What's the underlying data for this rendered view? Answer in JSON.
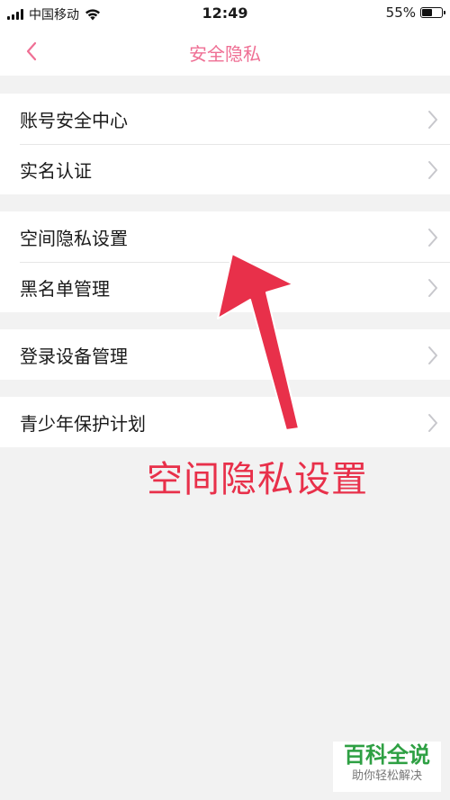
{
  "status_bar": {
    "carrier": "中国移动",
    "time": "12:49",
    "battery_pct": "55%",
    "battery_level": 0.55
  },
  "nav": {
    "title": "安全隐私",
    "back_icon": "chevron-left-icon"
  },
  "groups": [
    {
      "items": [
        {
          "label": "账号安全中心"
        },
        {
          "label": "实名认证"
        }
      ]
    },
    {
      "items": [
        {
          "label": "空间隐私设置"
        },
        {
          "label": "黑名单管理"
        }
      ]
    },
    {
      "items": [
        {
          "label": "登录设备管理"
        }
      ]
    },
    {
      "items": [
        {
          "label": "青少年保护计划"
        }
      ]
    }
  ],
  "annotation": {
    "text": "空间隐私设置",
    "color": "#e8304a"
  },
  "watermark": {
    "title": "百科全说",
    "subtitle": "助你轻松解决"
  },
  "colors": {
    "accent": "#ef6f94",
    "background": "#f2f2f2",
    "chevron": "#c7c7cc"
  }
}
